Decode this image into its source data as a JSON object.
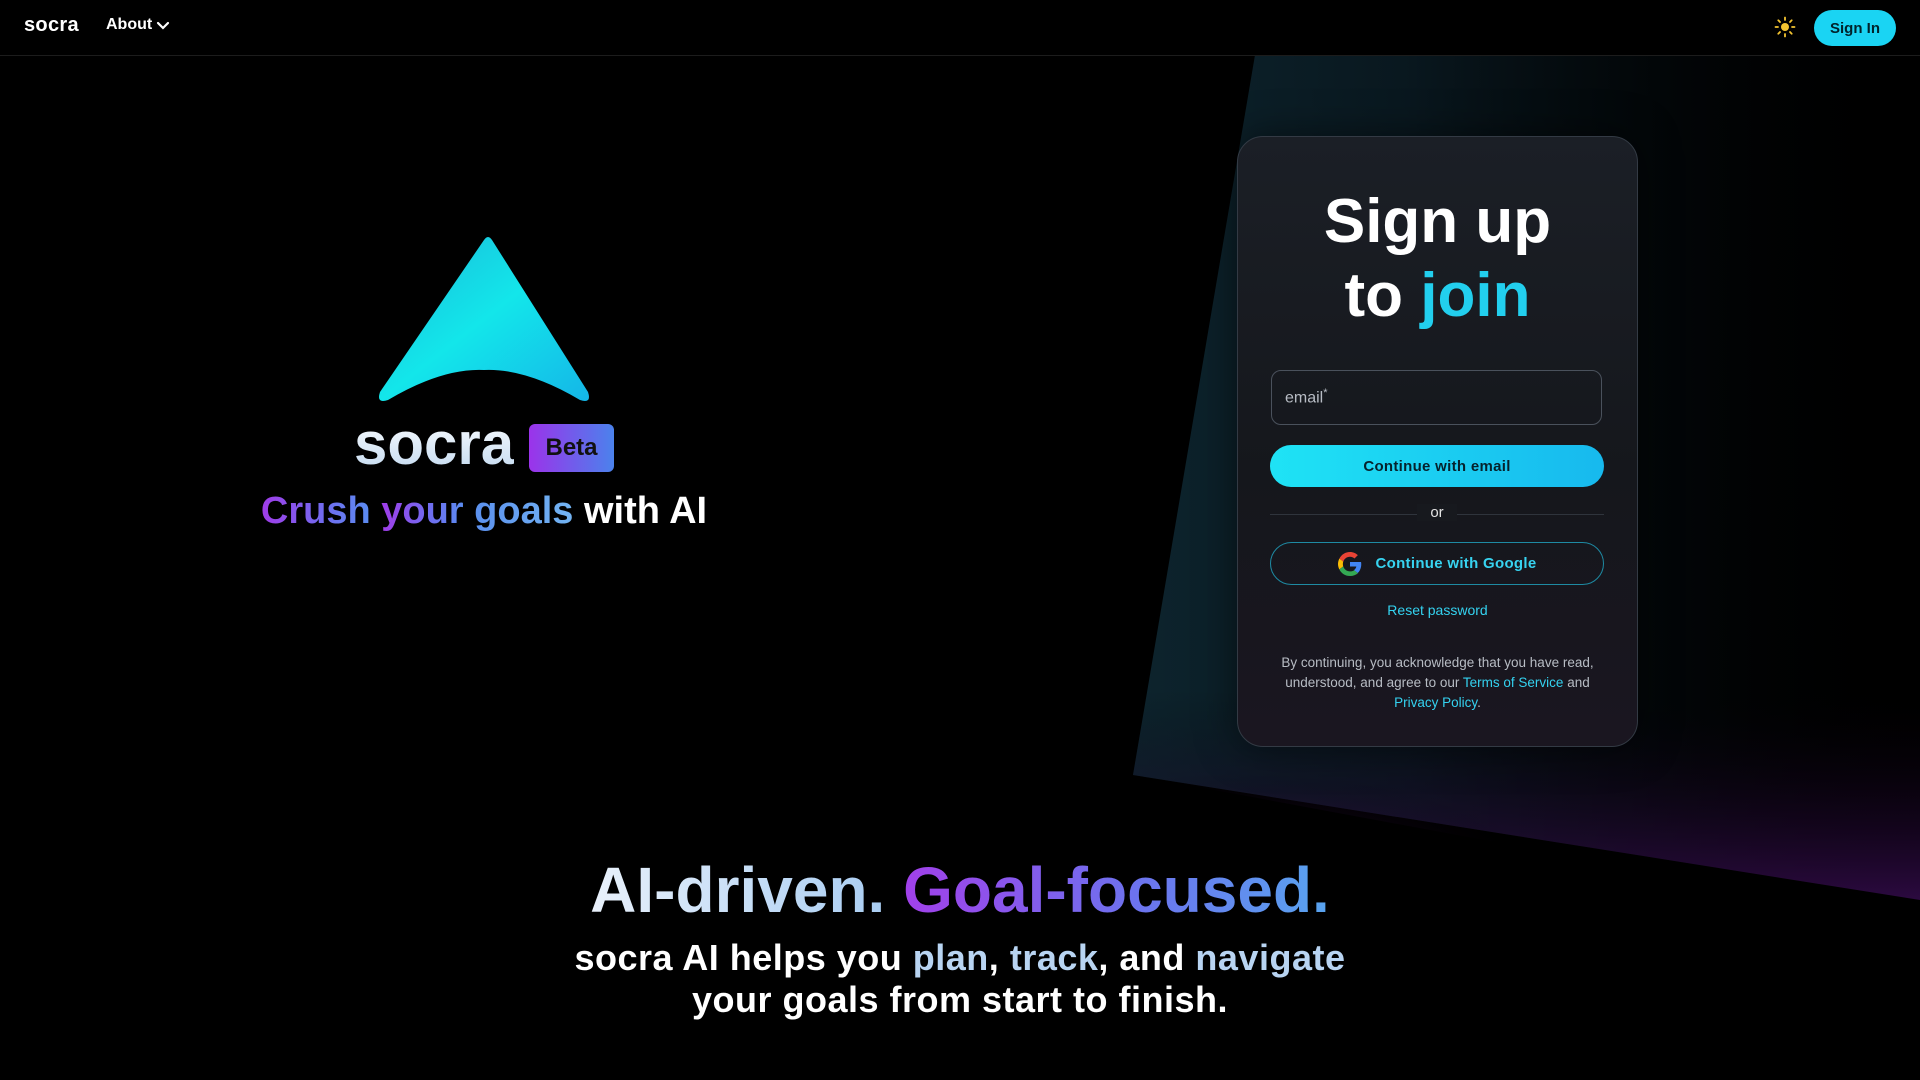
{
  "nav": {
    "brand": "socra",
    "about_label": "About",
    "signin_label": "Sign In"
  },
  "hero": {
    "logo_name": "socra",
    "beta_label": "Beta",
    "tagline_part1": "Crush",
    "tagline_part2": "your",
    "tagline_part3": "goals",
    "tagline_part4": "with AI"
  },
  "signup": {
    "title_line1": "Sign up",
    "title_to": "to",
    "title_join": "join",
    "email_label": "email",
    "email_required_mark": "*",
    "continue_email_label": "Continue with email",
    "or_label": "or",
    "continue_google_label": "Continue with Google",
    "reset_label": "Reset password",
    "legal_part1": "By continuing, you acknowledge that you have read, understood, and agree to our",
    "terms_label": "Terms of Service",
    "legal_and": "and",
    "privacy_label": "Privacy Policy",
    "legal_end": "."
  },
  "section": {
    "headline_part1": "AI-driven.",
    "headline_part2": "Goal-focused.",
    "sub_part1": "socra AI helps you",
    "sub_plan": "plan",
    "sub_comma1": ",",
    "sub_track": "track",
    "sub_comma2": ", and",
    "sub_navigate": "navigate",
    "sub_line2": "your goals from start to finish."
  },
  "icons": {
    "theme_toggle": "sun-icon",
    "about_chevron": "chevron-down-icon",
    "google": "google-icon",
    "logo": "socra-arrow-logo"
  },
  "colors": {
    "accent_cyan": "#22cfee",
    "purple": "#a03ce8",
    "blue": "#5b90ee",
    "background": "#000000"
  }
}
